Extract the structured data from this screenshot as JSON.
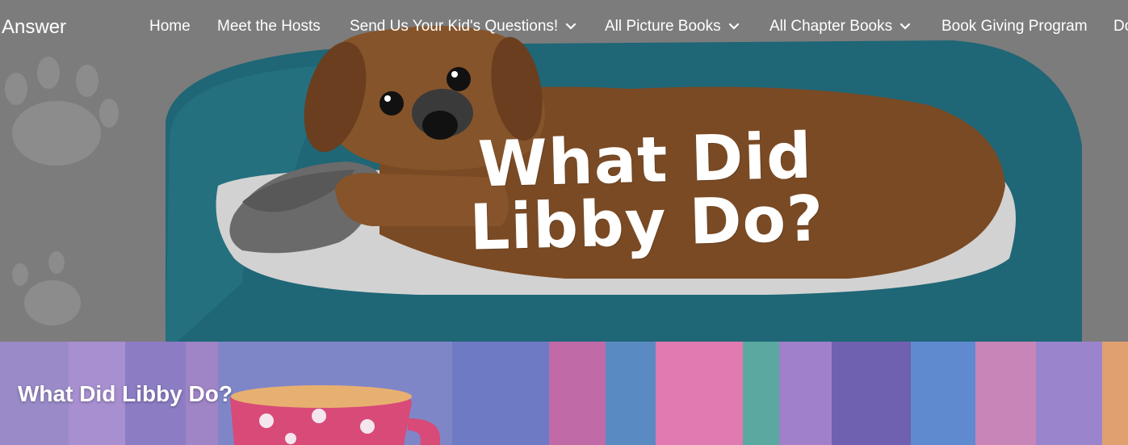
{
  "site": {
    "brand": "Answer"
  },
  "nav": {
    "items": [
      {
        "label": "Home",
        "has_dropdown": false
      },
      {
        "label": "Meet the Hosts",
        "has_dropdown": false
      },
      {
        "label": "Send Us Your Kid's Questions!",
        "has_dropdown": true
      },
      {
        "label": "All Picture Books",
        "has_dropdown": true
      },
      {
        "label": "All Chapter Books",
        "has_dropdown": true
      },
      {
        "label": "Book Giving Program",
        "has_dropdown": false
      },
      {
        "label": "Do",
        "has_dropdown": false
      }
    ]
  },
  "hero": {
    "title": "What Did Libby Do?"
  },
  "banner": {
    "title": "What Did Libby Do?"
  },
  "colors": {
    "hero_bg": "#7a7a7a",
    "bed_teal": "#1e6a7a",
    "dog_brown": "#7a4a25",
    "banner_purple": "#8a78c0",
    "text": "#ffffff"
  }
}
